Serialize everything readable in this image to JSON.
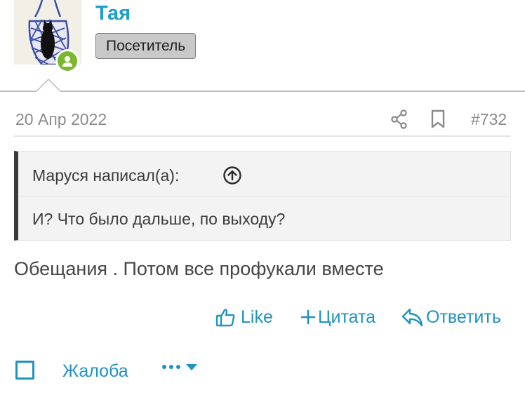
{
  "user": {
    "name": "Тая",
    "role": "Посетитель",
    "avatar_icon": "avatar-image",
    "online_icon": "user-online-icon",
    "online_color": "#7cb82f"
  },
  "post": {
    "date": "20 Апр 2022",
    "number": "#732",
    "share_icon": "share-icon",
    "bookmark_icon": "bookmark-icon"
  },
  "quote": {
    "author": "Маруся написал(а):",
    "jump_icon": "arrow-up-circle-icon",
    "text": "И? Что было дальше, по выходу?"
  },
  "message": "Обещания . Потом все профукали вместе",
  "actions": {
    "like": "Like",
    "quote": "Цитата",
    "reply": "Ответить"
  },
  "footer": {
    "report": "Жалоба"
  },
  "colors": {
    "link": "#1f93c0",
    "username": "#1a9fc9"
  }
}
